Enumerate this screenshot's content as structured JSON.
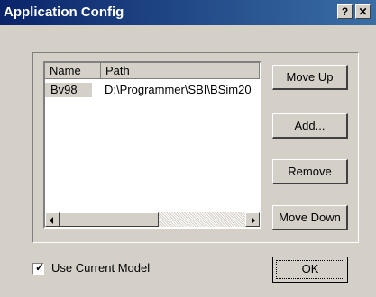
{
  "window": {
    "title": "Application Config",
    "help_button": "?",
    "close_button": "✕"
  },
  "list": {
    "columns": [
      "Name",
      "Path"
    ],
    "rows": [
      {
        "name": "Bv98",
        "path": "D:\\Programmer\\SBI\\BSim20"
      }
    ]
  },
  "buttons": {
    "move_up": "Move Up",
    "add": "Add...",
    "remove": "Remove",
    "move_down": "Move Down",
    "ok": "OK"
  },
  "options": {
    "use_current_model_label": "Use Current Model",
    "use_current_model_checked": true
  },
  "colors": {
    "titlebar_start": "#0a246a",
    "titlebar_end": "#3a6ea5",
    "face": "#d4d0c8"
  }
}
